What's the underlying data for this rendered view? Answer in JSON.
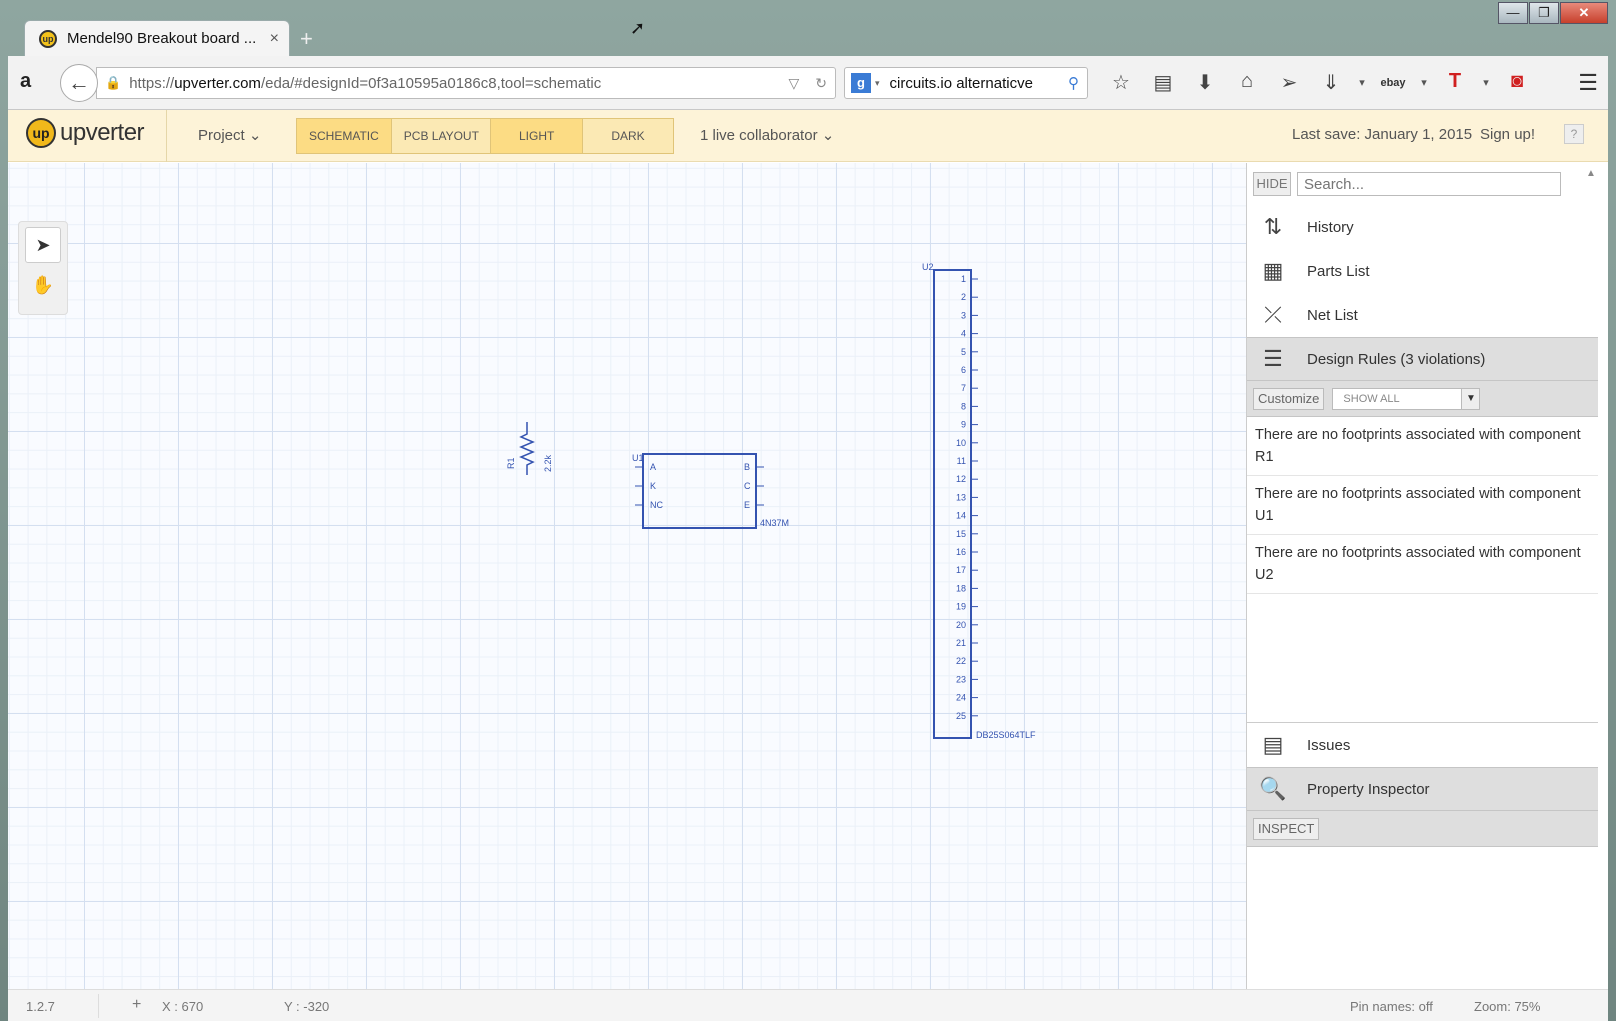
{
  "browser": {
    "tab_title": "Mendel90 Breakout board ...",
    "tab_close": "×",
    "new_tab": "+",
    "url_prefix": "https://",
    "url_domain": "upverter.com",
    "url_path": "/eda/#designId=0f3a10595a0186c8,tool=schematic",
    "search_value": "circuits.io alternaticve",
    "window_buttons": {
      "minimize": "—",
      "maximize": "❐",
      "close": "✕"
    }
  },
  "app": {
    "logo_text": "upverter",
    "project_menu": "Project",
    "view_tabs": [
      "SCHEMATIC",
      "PCB LAYOUT"
    ],
    "theme_tabs": [
      "LIGHT",
      "DARK"
    ],
    "collaborators": "1 live collaborator",
    "last_save": "Last save: January 1, 2015",
    "signup": "Sign up!",
    "help": "?"
  },
  "schematic": {
    "r1": {
      "ref": "R1",
      "value": "2.2k"
    },
    "u1": {
      "ref": "U1",
      "part": "4N37M",
      "left_pins": [
        "A",
        "K",
        "NC"
      ],
      "right_pins": [
        "B",
        "C",
        "E"
      ]
    },
    "u2": {
      "ref": "U2",
      "part": "DB25S064TLF",
      "pin_count": 25
    }
  },
  "panel": {
    "hide": "HIDE",
    "search_placeholder": "Search...",
    "items": {
      "history": "History",
      "parts_list": "Parts List",
      "net_list": "Net List",
      "design_rules": "Design Rules (3 violations)",
      "issues": "Issues",
      "property_inspector": "Property Inspector"
    },
    "customize": "Customize",
    "show_filter": "SHOW ALL",
    "violations": [
      "There are no footprints associated with component R1",
      "There are no footprints associated with component U1",
      "There are no footprints associated with component U2"
    ],
    "inspect": "INSPECT"
  },
  "status": {
    "version": "1.2.7",
    "x_label": "X : 670",
    "y_label": "Y : -320",
    "pin_names": "Pin names: off",
    "zoom": "Zoom: 75%"
  }
}
